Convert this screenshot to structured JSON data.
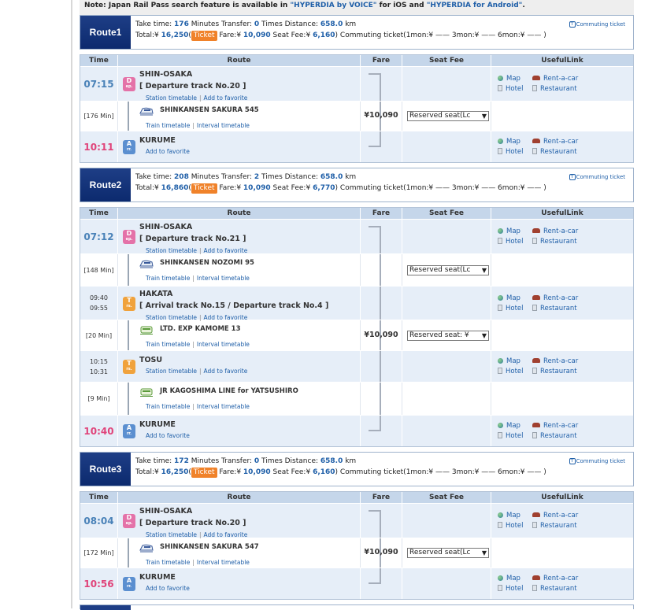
{
  "note": {
    "prefix": "Note: Japan Rail Pass search feature is available in ",
    "link1": "\"HYPERDIA by VOICE\"",
    "mid": " for iOS and ",
    "link2": "\"HYPERDIA for Android\"",
    "suffix": "."
  },
  "common": {
    "commuting_ticket": "Commuting ticket",
    "ticket_badge": "Ticket",
    "headers": {
      "time": "Time",
      "route": "Route",
      "fare": "Fare",
      "seat_fee": "Seat Fee",
      "useful_link": "UsefulLink"
    },
    "station_timetable": "Station timetable",
    "add_favorite": "Add to favorite",
    "train_timetable": "Train timetable",
    "interval_timetable": "Interval timetable",
    "map": "Map",
    "rent_a_car": "Rent-a-car",
    "hotel": "Hotel",
    "restaurant": "Restaurant",
    "dep_badge": "D",
    "dep_sub": "ep.",
    "arr_badge": "A",
    "arr_sub": "rr.",
    "tr_badge": "T",
    "tr_sub": "rs."
  },
  "routes": [
    {
      "label": "Route1",
      "take_time": "176",
      "transfer": "0",
      "distance": "658.0",
      "total": "16,250",
      "fare": "10,090",
      "seat_fee": "6,160",
      "stations": {
        "s1": {
          "time": "07:15",
          "name": "SHIN-OSAKA",
          "track": "[ Departure track No.20 ]"
        },
        "seg1": {
          "dur": "[176 Min]",
          "train": "SHINKANSEN SAKURA 545",
          "fare": "¥10,090",
          "seat": "Reserved seat(Lc"
        },
        "s2": {
          "time": "10:11",
          "name": "KURUME"
        }
      }
    },
    {
      "label": "Route2",
      "take_time": "208",
      "transfer": "2",
      "distance": "658.0",
      "total": "16,860",
      "fare": "10,090",
      "seat_fee": "6,770",
      "stations": {
        "s1": {
          "time": "07:12",
          "name": "SHIN-OSAKA",
          "track": "[ Departure track No.21 ]"
        },
        "seg1": {
          "dur": "[148 Min]",
          "train": "SHINKANSEN NOZOMI 95",
          "seat": "Reserved seat(Lc"
        },
        "s2": {
          "arr": "09:40",
          "dep": "09:55",
          "name": "HAKATA",
          "track": "[ Arrival track No.15 / Departure track No.4 ]"
        },
        "seg2": {
          "dur": "[20 Min]",
          "train": "LTD. EXP KAMOME 13",
          "fare": "¥10,090",
          "seat": "Reserved seat: ¥"
        },
        "s3": {
          "arr": "10:15",
          "dep": "10:31",
          "name": "TOSU"
        },
        "seg3": {
          "dur": "[9 Min]",
          "train": "JR KAGOSHIMA LINE  for YATSUSHIRO"
        },
        "s4": {
          "time": "10:40",
          "name": "KURUME"
        }
      }
    },
    {
      "label": "Route3",
      "take_time": "172",
      "transfer": "0",
      "distance": "658.0",
      "total": "16,250",
      "fare": "10,090",
      "seat_fee": "6,160",
      "stations": {
        "s1": {
          "time": "08:04",
          "name": "SHIN-OSAKA",
          "track": "[ Departure track No.20 ]"
        },
        "seg1": {
          "dur": "[172 Min]",
          "train": "SHINKANSEN SAKURA 547",
          "fare": "¥10,090",
          "seat": "Reserved seat(Lc"
        },
        "s2": {
          "time": "10:56",
          "name": "KURUME"
        }
      }
    }
  ],
  "summary_text": {
    "take_time": "Take time: ",
    "minutes": " Minutes  Transfer: ",
    "times": " Times  Distance: ",
    "km": " km",
    "total": "Total:¥ ",
    "open_paren": "(",
    "fare": " Fare:¥ ",
    "seat_fee": "  Seat Fee:¥ ",
    "close_paren": ")",
    "commuting": "  Commuting ticket(1mon:¥ ——    3mon:¥ ——    6mon:¥ —— )"
  }
}
